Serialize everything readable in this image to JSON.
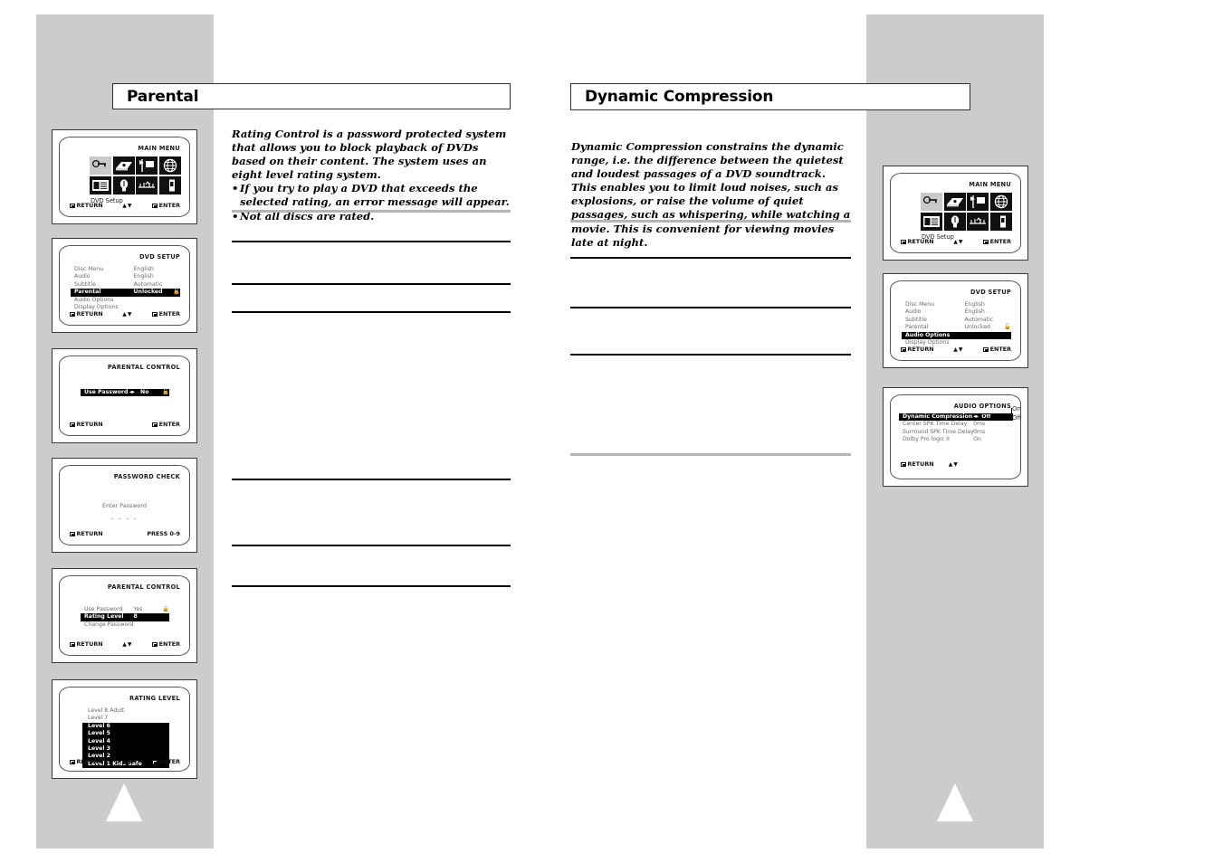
{
  "page": {
    "band_color": "#cccccc",
    "background": "#ffffff"
  },
  "left_section": {
    "header_title": "Parental",
    "intro": "Rating Control is a password protected system that allows you to block playback of DVDs based on their content. The system uses an eight level rating system.",
    "bullets": [
      "If you try to play a DVD that exceeds the selected rating, an error message will appear.",
      "Not all discs are rated."
    ],
    "screens": [
      {
        "id": "main-menu",
        "title": "MAIN MENU",
        "caption": "DVD Setup",
        "icons": [
          "disc-key-icon",
          "player-icon",
          "flag-display-icon",
          "globe-icon",
          "list-display-icon",
          "bulb-icon",
          "speaker-setup-icon",
          "book-icon"
        ],
        "footer_left": "RETURN",
        "footer_mid": "▲▼",
        "footer_right": "ENTER"
      },
      {
        "id": "dvd-setup",
        "title": "DVD SETUP",
        "rows": [
          {
            "label": "Disc Menu",
            "value": "English",
            "selected": false
          },
          {
            "label": "Audio",
            "value": "English",
            "selected": false
          },
          {
            "label": "Subtitle",
            "value": "Automatic",
            "selected": false
          },
          {
            "label": "Parental",
            "value": "Unlocked",
            "selected": true,
            "lock": true
          },
          {
            "label": "Audio Options",
            "value": "",
            "selected": false
          },
          {
            "label": "Display Options",
            "value": "",
            "selected": false
          }
        ],
        "footer_left": "RETURN",
        "footer_mid": "▲▼",
        "footer_right": "ENTER"
      },
      {
        "id": "parental-control-1",
        "title": "PARENTAL CONTROL",
        "rows": [
          {
            "label": "Use Password",
            "value": "No",
            "selected": true,
            "arrows": true,
            "lock": true
          }
        ],
        "footer_left": "RETURN",
        "footer_mid": "",
        "footer_right": "ENTER"
      },
      {
        "id": "password-check",
        "title": "PASSWORD CHECK",
        "prompt": "Enter Password",
        "mask": "– – – –",
        "footer_left": "RETURN",
        "footer_mid": "",
        "footer_right": "PRESS 0-9"
      },
      {
        "id": "parental-control-2",
        "title": "PARENTAL CONTROL",
        "rows": [
          {
            "label": "Use Password",
            "value": "Yes",
            "selected": false,
            "lock": true
          },
          {
            "label": "Rating Level",
            "value": "8",
            "selected": true
          },
          {
            "label": "Change Password",
            "value": "",
            "selected": false
          }
        ],
        "footer_left": "RETURN",
        "footer_mid": "▲▼",
        "footer_right": "ENTER"
      },
      {
        "id": "rating-level",
        "title": "RATING LEVEL",
        "items": [
          {
            "label": "Level 8 Adult",
            "highlighted": false
          },
          {
            "label": "Level 7",
            "highlighted": false
          },
          {
            "label": "Level 6",
            "highlighted": true
          },
          {
            "label": "Level 5",
            "highlighted": true
          },
          {
            "label": "Level 4",
            "highlighted": true
          },
          {
            "label": "Level 3",
            "highlighted": true
          },
          {
            "label": "Level 2",
            "highlighted": true
          },
          {
            "label": "Level 1 Kids Safe",
            "highlighted": true
          }
        ],
        "footer_left": "RETURN",
        "footer_mid": "▲▼",
        "footer_right": "ENTER"
      }
    ]
  },
  "right_section": {
    "header_title": "Dynamic Compression",
    "intro": "Dynamic Compression constrains the dynamic range, i.e. the difference between the quietest and loudest passages of a DVD soundtrack. This enables you to limit loud noises, such as explosions, or raise the volume of quiet passages, such as whispering, while watching a movie. This is convenient for viewing movies late at night.",
    "screens": [
      {
        "id": "main-menu",
        "title": "MAIN MENU",
        "caption": "DVD Setup",
        "icons": [
          "disc-key-icon",
          "player-icon",
          "flag-display-icon",
          "globe-icon",
          "list-display-icon",
          "bulb-icon",
          "speaker-setup-icon",
          "book-icon"
        ],
        "footer_left": "RETURN",
        "footer_mid": "▲▼",
        "footer_right": "ENTER"
      },
      {
        "id": "dvd-setup",
        "title": "DVD SETUP",
        "rows": [
          {
            "label": "Disc Menu",
            "value": "English",
            "selected": false
          },
          {
            "label": "Audio",
            "value": "English",
            "selected": false
          },
          {
            "label": "Subtitle",
            "value": "Automatic",
            "selected": false
          },
          {
            "label": "Parental",
            "value": "Unlocked",
            "selected": false,
            "lock": true
          },
          {
            "label": "Audio Options",
            "value": "",
            "selected": true
          },
          {
            "label": "Display Options",
            "value": "",
            "selected": false
          }
        ],
        "footer_left": "RETURN",
        "footer_mid": "▲▼",
        "footer_right": "ENTER"
      },
      {
        "id": "audio-options",
        "title": "AUDIO OPTIONS",
        "rows": [
          {
            "label": "Dynamic Compression",
            "value": "Off",
            "selected": true,
            "arrows": true
          },
          {
            "label": "Center SPK Time Delay",
            "value": "0ms",
            "selected": false
          },
          {
            "label": "Surround SPK Time Delay",
            "value": "0ms",
            "selected": false
          },
          {
            "label": "Dolby Pro logic II",
            "value": "On",
            "selected": false
          }
        ],
        "footer_left": "RETURN",
        "footer_mid": "▲▼",
        "footer_right": "",
        "callout": [
          "On",
          "Off"
        ]
      }
    ]
  }
}
